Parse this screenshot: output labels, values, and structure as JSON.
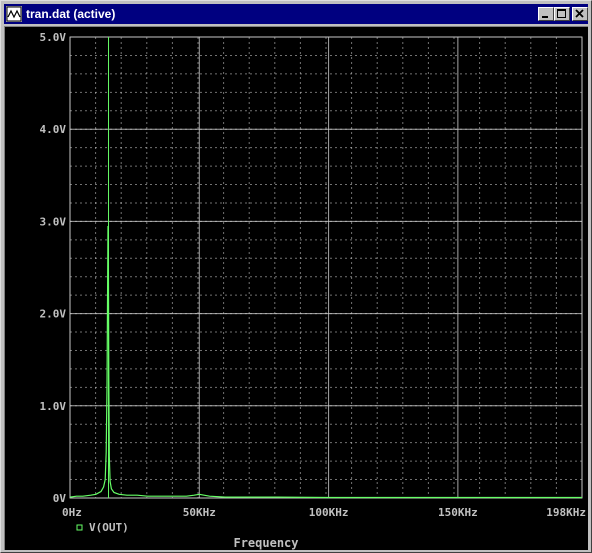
{
  "window": {
    "title": "tran.dat (active)",
    "app_icon": "probe-waveform-icon",
    "buttons": {
      "minimize": "minimize-icon",
      "maximize": "maximize-icon",
      "close": "close-icon"
    }
  },
  "colors": {
    "background": "#000000",
    "grid": "#d0d0d0",
    "trace": "#66ff66",
    "cursor_line": "#66ff66",
    "axis_text": "#c0c0c0",
    "title_bar": "#000080"
  },
  "chart_data": {
    "type": "line",
    "xlabel": "Frequency",
    "ylabel": "",
    "xlim": [
      0,
      198000
    ],
    "ylim": [
      0,
      5
    ],
    "x_ticks": [
      {
        "value": 0,
        "label": "0Hz"
      },
      {
        "value": 50000,
        "label": "50KHz"
      },
      {
        "value": 100000,
        "label": "100KHz"
      },
      {
        "value": 150000,
        "label": "150KHz"
      },
      {
        "value": 198000,
        "label": "198KHz"
      }
    ],
    "y_ticks": [
      {
        "value": 0,
        "label": "0V"
      },
      {
        "value": 1,
        "label": "1.0V"
      },
      {
        "value": 2,
        "label": "2.0V"
      },
      {
        "value": 3,
        "label": "3.0V"
      },
      {
        "value": 4,
        "label": "4.0V"
      },
      {
        "value": 5,
        "label": "5.0V"
      }
    ],
    "grid": true,
    "cursor": {
      "x": 14900
    },
    "series": [
      {
        "name": "V(OUT)",
        "x": [
          0,
          2500,
          5000,
          8000,
          10000,
          12000,
          13000,
          13600,
          14000,
          14300,
          14500,
          14700,
          14850,
          15000,
          15200,
          15500,
          16000,
          17000,
          19000,
          22000,
          26000,
          30000,
          35000,
          40000,
          45000,
          48000,
          50000,
          54000,
          60000,
          70000,
          80000,
          100000,
          120000,
          150000,
          175000,
          198000
        ],
        "y": [
          0.01,
          0.02,
          0.02,
          0.03,
          0.04,
          0.07,
          0.12,
          0.2,
          0.5,
          1.2,
          2.1,
          2.95,
          2.5,
          1.3,
          0.45,
          0.18,
          0.1,
          0.06,
          0.04,
          0.03,
          0.03,
          0.02,
          0.02,
          0.02,
          0.02,
          0.03,
          0.04,
          0.02,
          0.01,
          0.01,
          0.01,
          0.005,
          0.005,
          0.005,
          0.005,
          0.005
        ]
      }
    ],
    "legend": {
      "position": "bottom-left"
    }
  }
}
